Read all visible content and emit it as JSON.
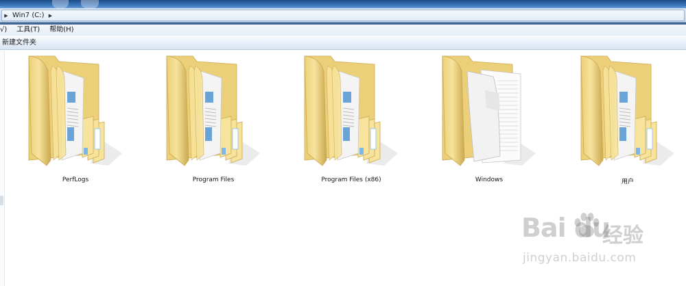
{
  "address": {
    "path": [
      "Win7 (C:)"
    ]
  },
  "menu": {
    "items": [
      "√)",
      "工具(T)",
      "帮助(H)"
    ]
  },
  "toolbar": {
    "new_folder_label": "新建文件夹"
  },
  "items": [
    {
      "name": "PerfLogs",
      "icon": "folder-with-documents-icon"
    },
    {
      "name": "Program Files",
      "icon": "folder-with-documents-icon"
    },
    {
      "name": "Program Files (x86)",
      "icon": "folder-with-documents-icon"
    },
    {
      "name": "Windows",
      "icon": "folder-with-blank-pages-icon"
    },
    {
      "name": "用户",
      "icon": "folder-with-documents-icon"
    }
  ],
  "watermark": {
    "logo": "Bai du",
    "cn": "经验",
    "url": "jingyan.baidu.com"
  },
  "colors": {
    "folder_light": "#f7e39c",
    "folder_mid": "#ecd079",
    "folder_dark": "#caa94f",
    "title_blue": "#3f7bc0"
  }
}
